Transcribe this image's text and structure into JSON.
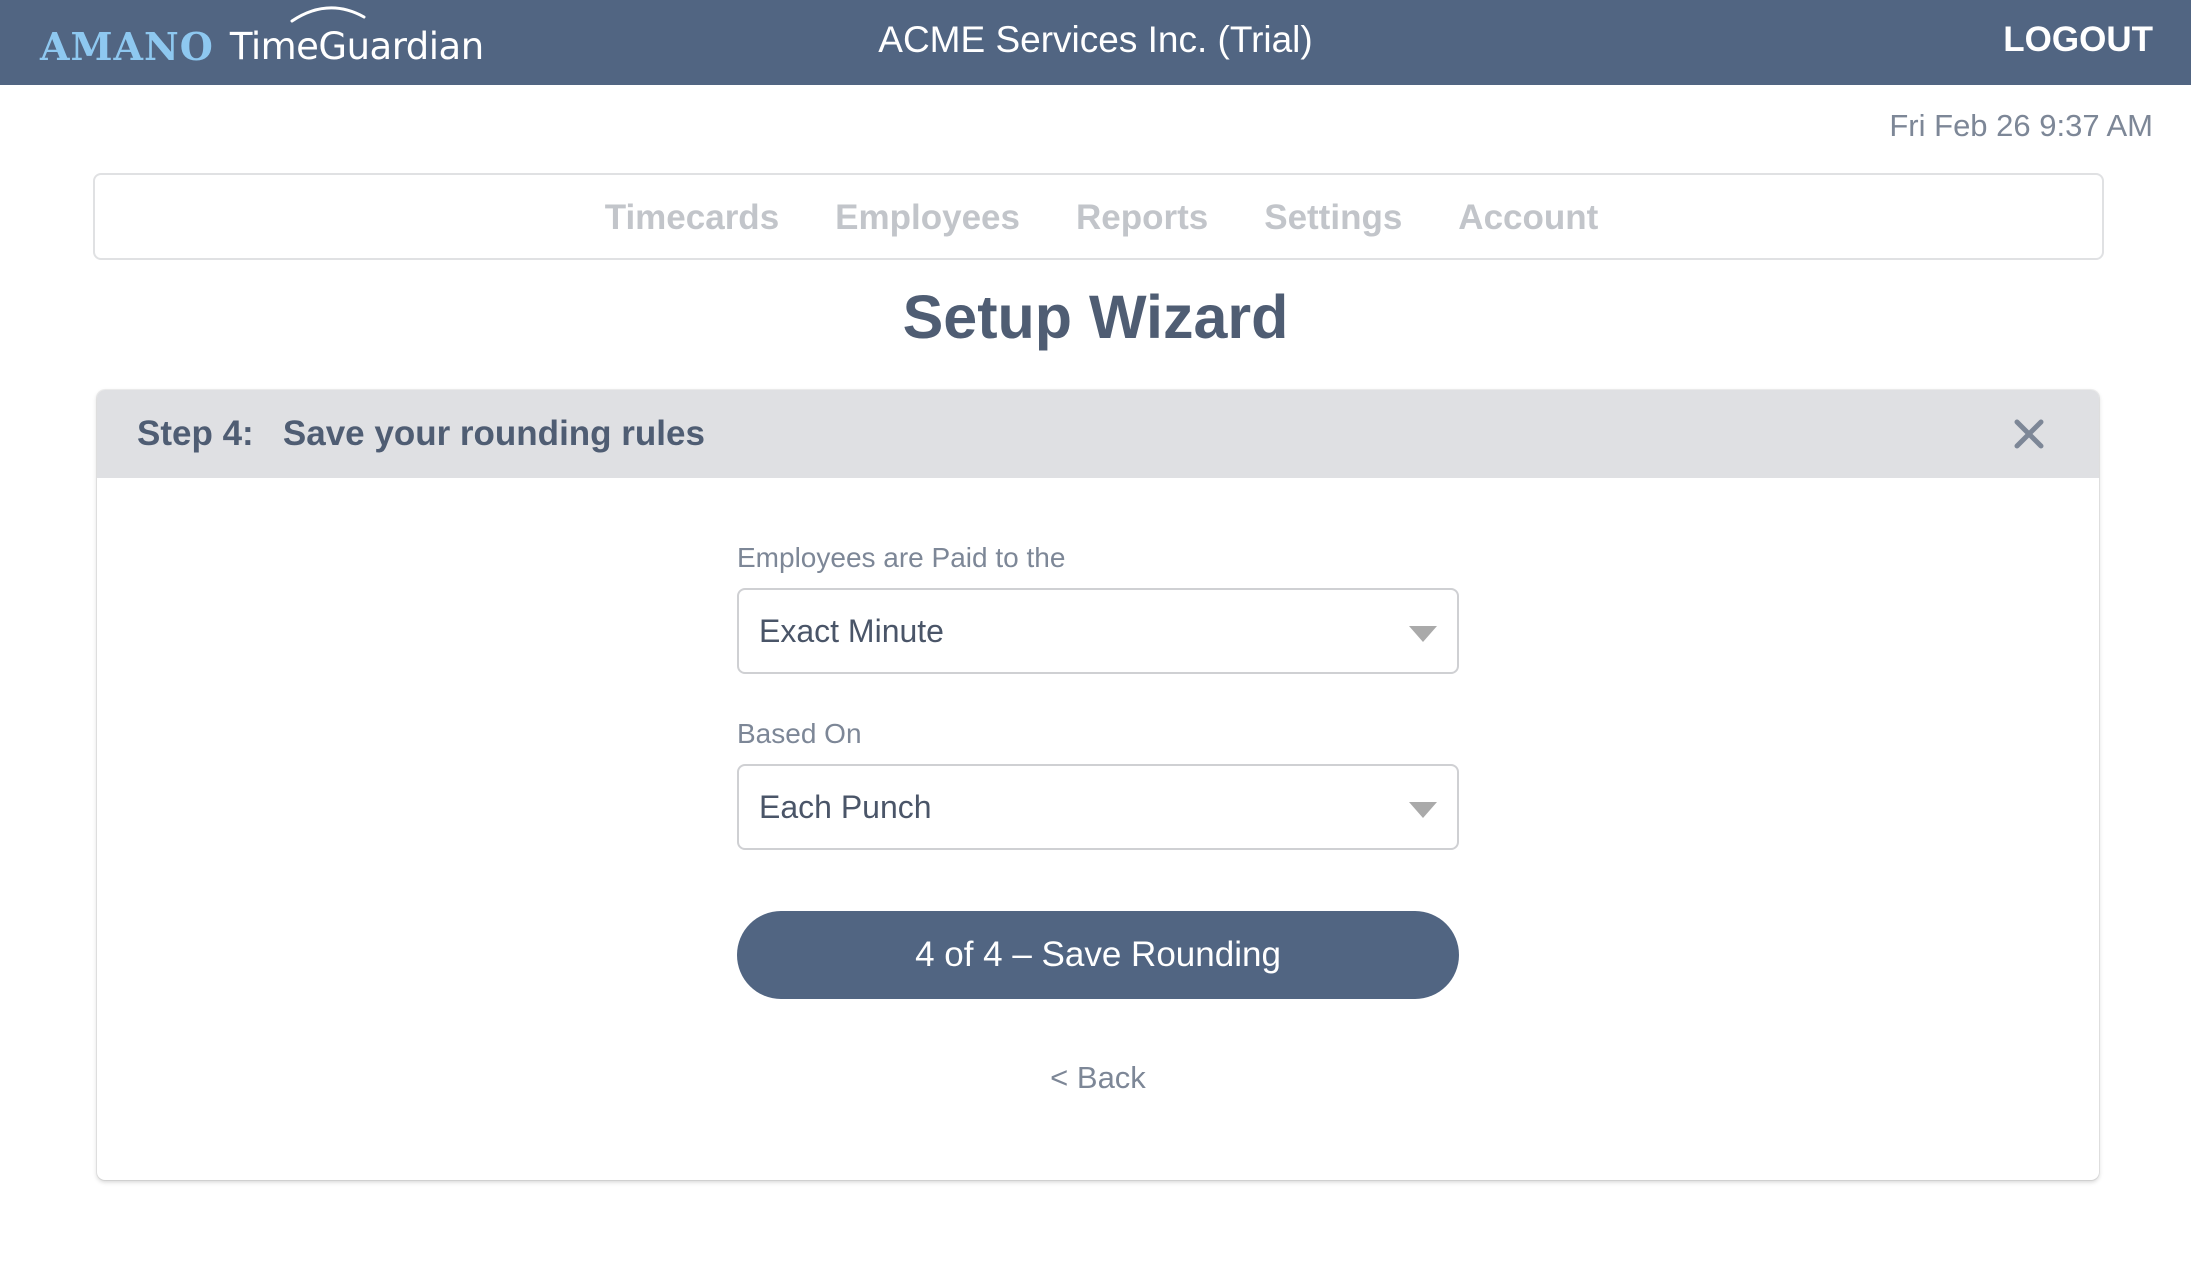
{
  "header": {
    "logo_brand": "AMANO",
    "logo_product": "TimeGuardian",
    "company": "ACME Services Inc. (Trial)",
    "logout_label": "LOGOUT",
    "datetime": "Fri Feb 26 9:37 AM"
  },
  "nav": {
    "items": [
      {
        "label": "Timecards"
      },
      {
        "label": "Employees"
      },
      {
        "label": "Reports"
      },
      {
        "label": "Settings"
      },
      {
        "label": "Account"
      }
    ]
  },
  "page": {
    "title": "Setup Wizard"
  },
  "wizard": {
    "step_label": "Step 4:",
    "step_title": "Save your rounding rules",
    "close_icon": "close-icon",
    "fields": [
      {
        "label": "Employees are Paid to the",
        "value": "Exact Minute"
      },
      {
        "label": "Based On",
        "value": "Each Punch"
      }
    ],
    "primary_button": "4 of 4 – Save Rounding",
    "back_link": "< Back"
  },
  "colors": {
    "header_bg": "#516582",
    "brand_accent": "#8ec8f0",
    "button_bg": "#516582",
    "card_header_bg": "#dfe0e3",
    "title_text": "#4f5d73",
    "nav_text": "#c2c5ca"
  }
}
